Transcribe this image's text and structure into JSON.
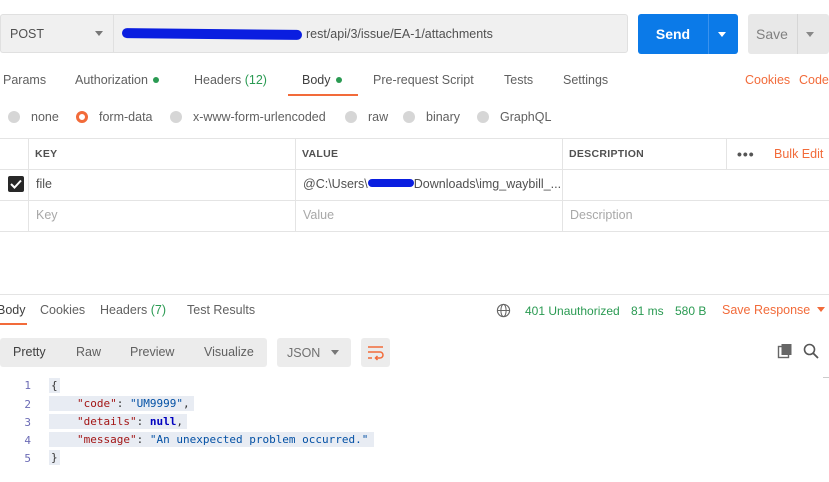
{
  "request": {
    "method": "POST",
    "url_visible": "rest/api/3/issue/EA-1/attachments",
    "send_label": "Send",
    "save_label": "Save"
  },
  "request_tabs": {
    "params": "Params",
    "authorization": "Authorization",
    "headers": "Headers",
    "headers_count": "(12)",
    "body": "Body",
    "prerequest": "Pre-request Script",
    "tests": "Tests",
    "settings": "Settings",
    "cookies": "Cookies",
    "code": "Code"
  },
  "body_types": {
    "none": "none",
    "form_data": "form-data",
    "urlencoded": "x-www-form-urlencoded",
    "raw": "raw",
    "binary": "binary",
    "graphql": "GraphQL",
    "selected": "form-data"
  },
  "params_table": {
    "headers": {
      "key": "KEY",
      "value": "VALUE",
      "description": "DESCRIPTION"
    },
    "bulk_edit": "Bulk Edit",
    "rows": [
      {
        "checked": true,
        "key": "file",
        "value_prefix": "@C:\\Users\\",
        "value_suffix": "Downloads\\img_waybill_...",
        "description": ""
      }
    ],
    "placeholders": {
      "key": "Key",
      "value": "Value",
      "description": "Description"
    }
  },
  "response": {
    "tabs": {
      "body": "Body",
      "cookies": "Cookies",
      "headers": "Headers",
      "headers_count": "(7)",
      "test_results": "Test Results"
    },
    "status": "401 Unauthorized",
    "time": "81 ms",
    "size": "580 B",
    "save_response": "Save Response",
    "view_modes": [
      "Pretty",
      "Raw",
      "Preview",
      "Visualize"
    ],
    "format": "JSON",
    "body_lines": [
      "1",
      "2",
      "3",
      "4",
      "5"
    ],
    "json": {
      "open": "{",
      "code_key": "\"code\"",
      "code_val": "\"UM9999\"",
      "details_key": "\"details\"",
      "details_val": "null",
      "message_key": "\"message\"",
      "message_val": "\"An unexpected problem occurred.\"",
      "close": "}"
    }
  },
  "colors": {
    "accent": "#f26b3a",
    "primary": "#0b7ae8",
    "success": "#2a9a52"
  }
}
